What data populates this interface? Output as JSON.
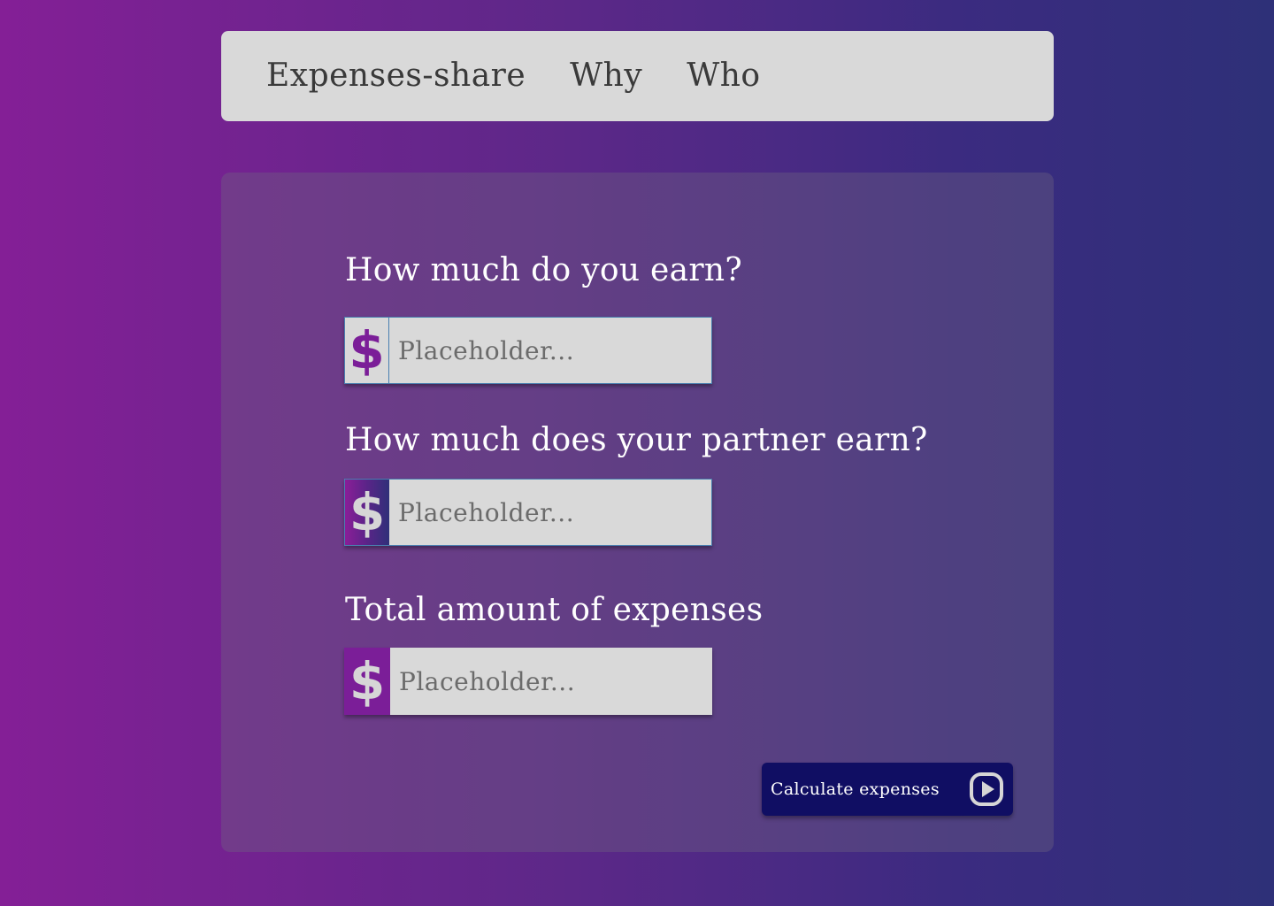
{
  "nav": {
    "items": [
      {
        "label": "Expenses-share"
      },
      {
        "label": "Why"
      },
      {
        "label": "Who"
      }
    ]
  },
  "form": {
    "fields": [
      {
        "label": "How much do you earn?",
        "currency_symbol": "$",
        "placeholder": "Placeholder...",
        "value": ""
      },
      {
        "label": "How much does your partner earn?",
        "currency_symbol": "$",
        "placeholder": "Placeholder...",
        "value": ""
      },
      {
        "label": "Total amount of expenses",
        "currency_symbol": "$",
        "placeholder": "Placeholder...",
        "value": ""
      }
    ],
    "submit": {
      "label": "Calculate expenses",
      "icon": "play-circle-icon"
    }
  },
  "colors": {
    "background_start": "#841f96",
    "background_end": "#2e3078",
    "nav_background": "#d9d9d9",
    "accent_purple": "#7b1e98",
    "button_navy": "#100e63"
  }
}
